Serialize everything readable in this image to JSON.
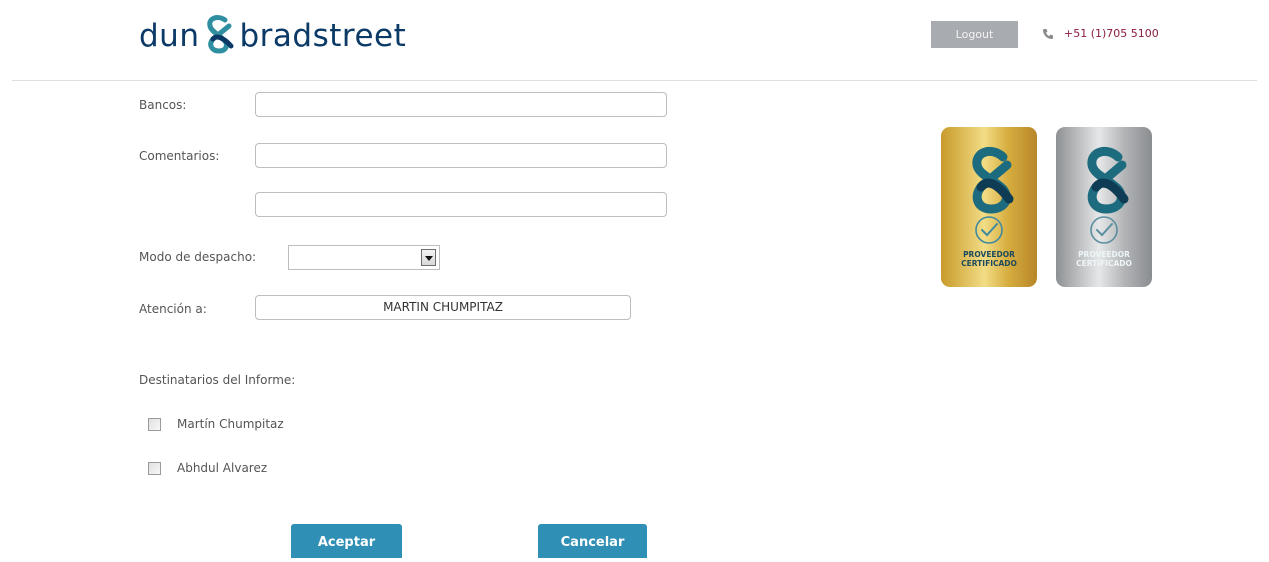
{
  "header": {
    "logo_left": "dun",
    "logo_right": "bradstreet",
    "logout_label": "Logout",
    "phone": "+51 (1)705 5100"
  },
  "form": {
    "bancos_label": "Bancos:",
    "bancos_value": "",
    "comentarios_label": "Comentarios:",
    "comentarios_value_1": "",
    "comentarios_value_2": "",
    "despacho_label": "Modo de despacho:",
    "despacho_value": "",
    "atencion_label": "Atención a:",
    "atencion_value": "MARTIN CHUMPITAZ",
    "destinatarios_label": "Destinatarios del Informe:",
    "recipients": [
      {
        "name": "Martín Chumpitaz",
        "checked": false
      },
      {
        "name": "Abhdul Alvarez",
        "checked": false
      }
    ],
    "accept_label": "Aceptar",
    "cancel_label": "Cancelar"
  },
  "badges": [
    {
      "line1": "PROVEEDOR",
      "line2": "CERTIFICADO",
      "color": "#d4a93a"
    },
    {
      "line1": "PROVEEDOR",
      "line2": "CERTIFICADO",
      "color": "#b7b9bb"
    }
  ],
  "colors": {
    "brand": "#0b3a66",
    "accent": "#2f8fb4",
    "phone": "#8b1c3b"
  }
}
